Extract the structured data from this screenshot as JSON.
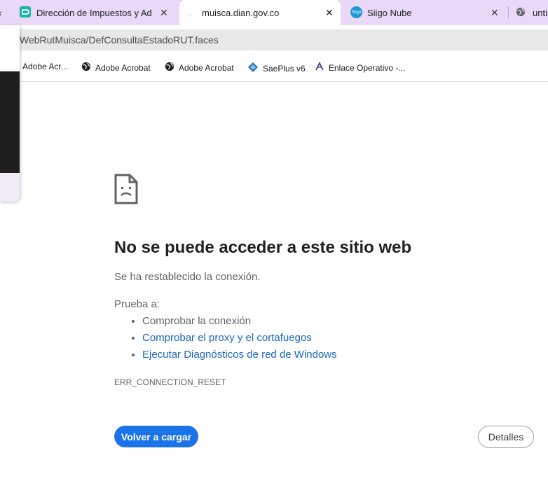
{
  "tabs": [
    {
      "title": "Dirección de Impuestos y Adua",
      "close": "✕",
      "favicon": "dian-icon",
      "active": false
    },
    {
      "title": "muisca.dian.gov.co",
      "close": "✕",
      "favicon": "loading-icon",
      "active": true
    },
    {
      "title": "Siigo Nube",
      "close": "✕",
      "favicon": "siigo-icon",
      "favicon_text": "Siigo",
      "active": false
    },
    {
      "title": "unti",
      "favicon": "globe-icon",
      "active": false
    }
  ],
  "address_bar": {
    "url": "WebRutMuisca/DefConsultaEstadoRUT.faces"
  },
  "bookmarks": [
    {
      "label": "Adobe Acr...",
      "icon": "globe-icon"
    },
    {
      "label": "Adobe Acrobat",
      "icon": "globe-icon"
    },
    {
      "label": "Adobe Acrobat",
      "icon": "globe-icon"
    },
    {
      "label": "SaePlus v6",
      "icon": "saeplus-icon"
    },
    {
      "label": "Enlace Operativo -...",
      "icon": "enlace-icon"
    }
  ],
  "error_page": {
    "icon": "sad-page-icon",
    "heading": "No se puede acceder a este sitio web",
    "subtext": "Se ha restablecido la conexión.",
    "try_label": "Prueba a:",
    "suggestions": [
      {
        "text": "Comprobar la conexión",
        "link": false
      },
      {
        "text": "Comprobar el proxy y el cortafuegos",
        "link": true
      },
      {
        "text": "Ejecutar Diagnósticos de red de Windows",
        "link": true
      }
    ],
    "error_code": "ERR_CONNECTION_RESET",
    "reload_button": "Volver a cargar",
    "details_button": "Detalles"
  },
  "colors": {
    "tab_strip": "#e9d8f6",
    "accent": "#1a73e8",
    "link": "#1a66c2"
  }
}
